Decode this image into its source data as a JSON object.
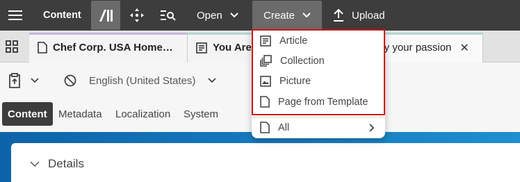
{
  "topbar": {
    "content_label": "Content",
    "open_label": "Open",
    "create_label": "Create",
    "upload_label": "Upload"
  },
  "tabs": [
    {
      "title": "Chef Corp. USA Home…"
    },
    {
      "title": "You Are"
    },
    {
      "title": "joy your passion"
    }
  ],
  "subbar": {
    "language": "English (United States)"
  },
  "section_tabs": [
    "Content",
    "Metadata",
    "Localization",
    "System"
  ],
  "card": {
    "details_label": "Details"
  },
  "dropdown": {
    "items": [
      "Article",
      "Collection",
      "Picture",
      "Page from Template"
    ],
    "all_label": "All"
  },
  "colors": {
    "topbar_bg": "#3d3d3d",
    "highlight": "#d3141a",
    "band_start": "#0d63a8",
    "band_end": "#1f8fcf"
  }
}
